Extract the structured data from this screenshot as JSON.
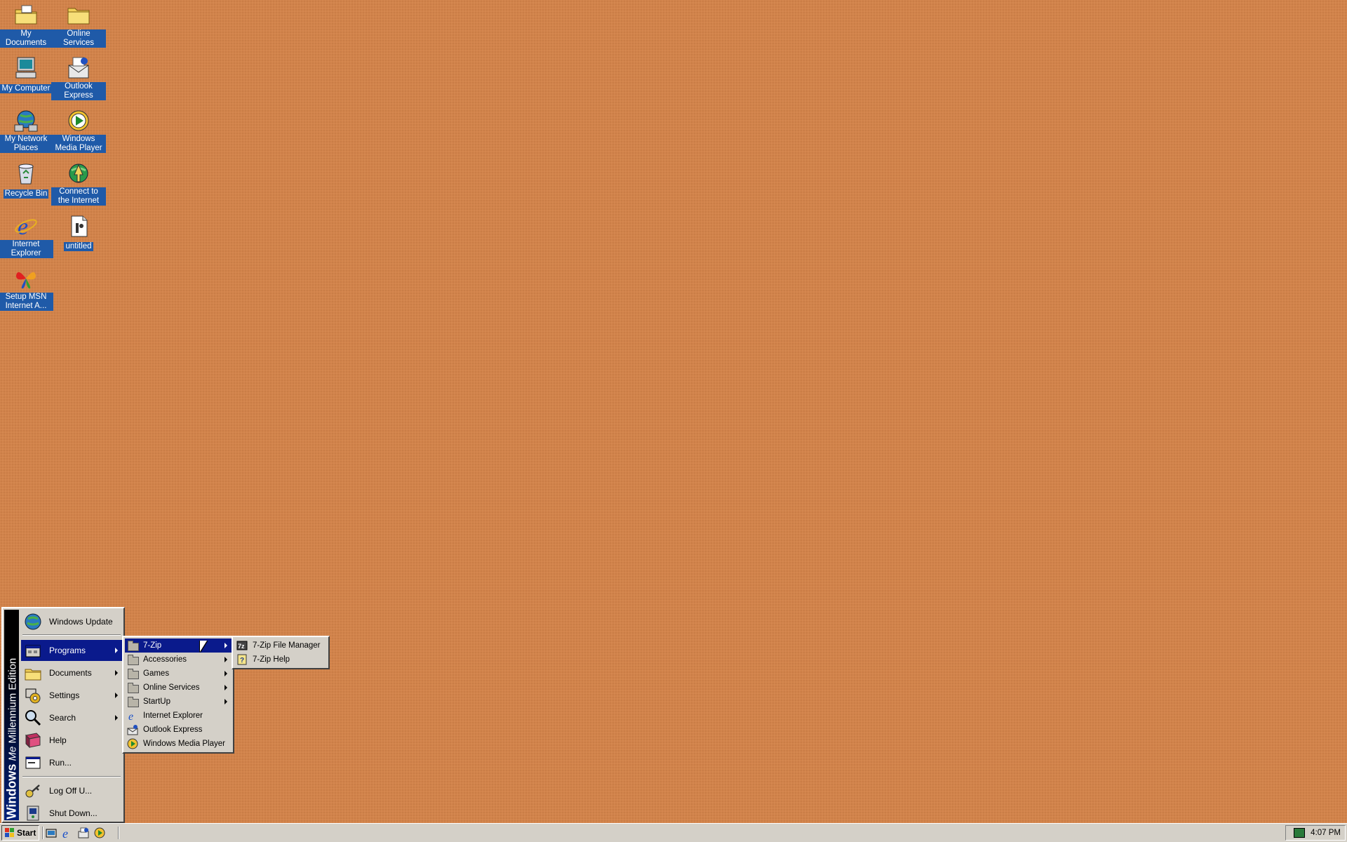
{
  "desktop": {
    "icons": [
      {
        "label": "My Documents"
      },
      {
        "label": "Online Services"
      },
      {
        "label": "My Computer"
      },
      {
        "label": "Outlook Express"
      },
      {
        "label": "My Network Places"
      },
      {
        "label": "Windows Media Player"
      },
      {
        "label": "Recycle Bin"
      },
      {
        "label": "Connect to the Internet"
      },
      {
        "label": "Internet Explorer"
      },
      {
        "label": "untitled"
      },
      {
        "label": "Setup MSN Internet A..."
      }
    ],
    "background_color": "#d2834a"
  },
  "start_menu": {
    "banner_bold": "Windows",
    "banner_me": "Me",
    "banner_text": "Millennium Edition",
    "items": [
      {
        "label": "Windows Update",
        "icon": "windows-update-icon"
      },
      {
        "label": "Programs",
        "icon": "programs-icon"
      },
      {
        "label": "Documents",
        "icon": "documents-icon"
      },
      {
        "label": "Settings",
        "icon": "settings-icon"
      },
      {
        "label": "Search",
        "icon": "search-icon"
      },
      {
        "label": "Help",
        "icon": "help-icon"
      },
      {
        "label": "Run...",
        "icon": "run-icon"
      },
      {
        "label": "Log Off U...",
        "icon": "log-off-icon"
      },
      {
        "label": "Shut Down...",
        "icon": "shut-down-icon"
      }
    ]
  },
  "programs_menu": {
    "items": [
      {
        "label": "7-Zip"
      },
      {
        "label": "Accessories"
      },
      {
        "label": "Games"
      },
      {
        "label": "Online Services"
      },
      {
        "label": "StartUp"
      },
      {
        "label": "Internet Explorer"
      },
      {
        "label": "Outlook Express"
      },
      {
        "label": "Windows Media Player"
      }
    ]
  },
  "sevenzip_menu": {
    "items": [
      {
        "label": "7-Zip File Manager"
      },
      {
        "label": "7-Zip Help"
      }
    ]
  },
  "taskbar": {
    "start_label": "Start",
    "clock": "4:07 PM"
  },
  "colors": {
    "highlight": "#0a1a8c",
    "menu_face": "#d4d0c8",
    "icon_label_bg": "#1f5aa8"
  }
}
